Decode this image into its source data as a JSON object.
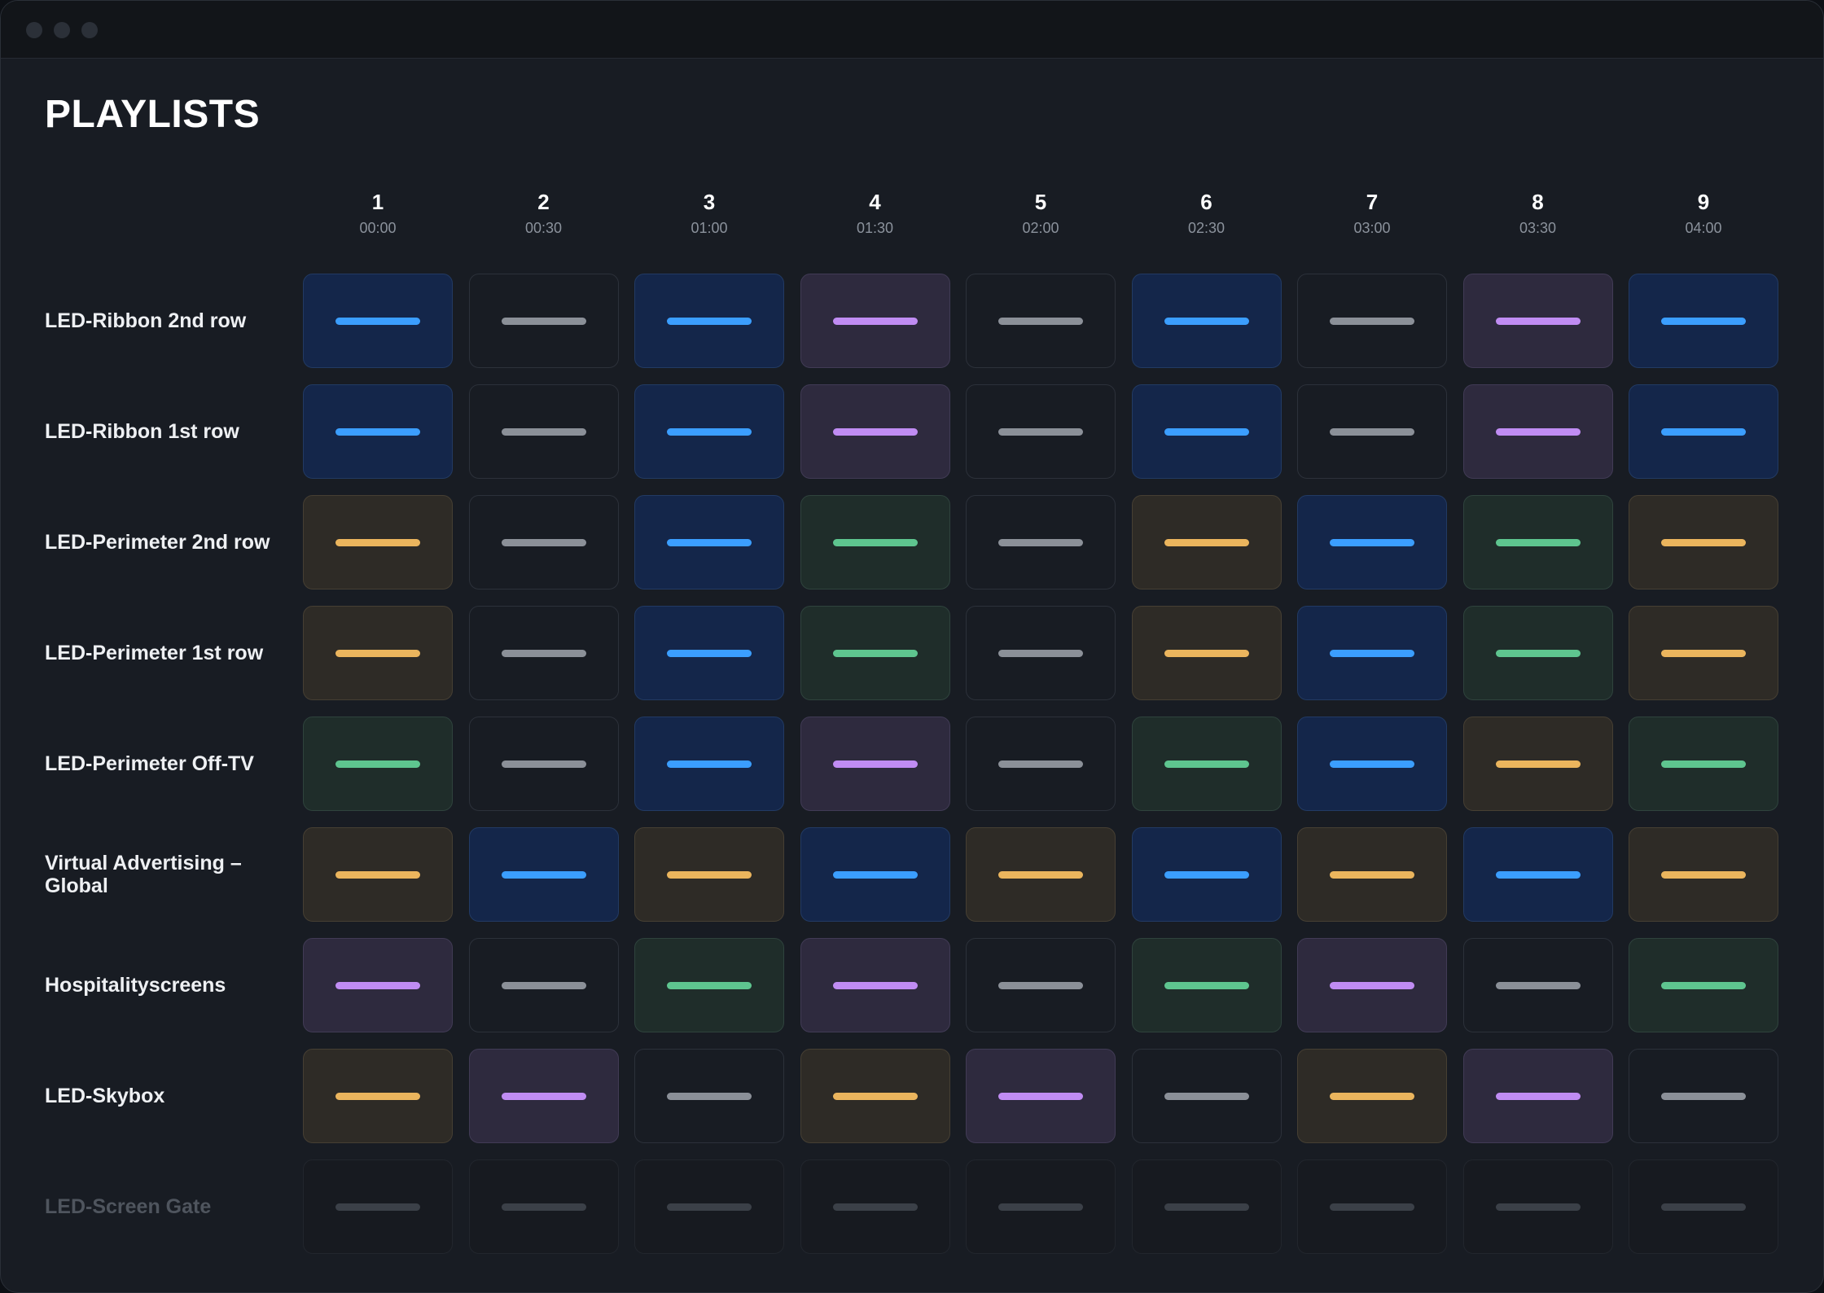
{
  "header": {
    "title": "PLAYLISTS"
  },
  "columns": [
    {
      "num": "1",
      "time": "00:00"
    },
    {
      "num": "2",
      "time": "00:30"
    },
    {
      "num": "3",
      "time": "01:00"
    },
    {
      "num": "4",
      "time": "01:30"
    },
    {
      "num": "5",
      "time": "02:00"
    },
    {
      "num": "6",
      "time": "02:30"
    },
    {
      "num": "7",
      "time": "03:00"
    },
    {
      "num": "8",
      "time": "03:30"
    },
    {
      "num": "9",
      "time": "04:00"
    }
  ],
  "rows": [
    {
      "label": "LED-Ribbon 2nd row",
      "disabled": false,
      "cells": [
        "blue",
        "gray",
        "blue",
        "purple",
        "gray",
        "blue",
        "gray",
        "purple",
        "blue"
      ]
    },
    {
      "label": "LED-Ribbon 1st row",
      "disabled": false,
      "cells": [
        "blue",
        "gray",
        "blue",
        "purple",
        "gray",
        "blue",
        "gray",
        "purple",
        "blue"
      ]
    },
    {
      "label": "LED-Perimeter 2nd row",
      "disabled": false,
      "cells": [
        "yellow",
        "gray",
        "blue",
        "green",
        "gray",
        "yellow",
        "blue",
        "green",
        "yellow"
      ]
    },
    {
      "label": "LED-Perimeter 1st row",
      "disabled": false,
      "cells": [
        "yellow",
        "gray",
        "blue",
        "green",
        "gray",
        "yellow",
        "blue",
        "green",
        "yellow"
      ]
    },
    {
      "label": "LED-Perimeter Off-TV",
      "disabled": false,
      "cells": [
        "green",
        "gray",
        "blue",
        "purple",
        "gray",
        "green",
        "blue",
        "yellow",
        "green"
      ]
    },
    {
      "label": "Virtual Advertising – Global",
      "disabled": false,
      "cells": [
        "yellow",
        "blue",
        "yellow",
        "blue",
        "yellow",
        "blue",
        "yellow",
        "blue",
        "yellow"
      ]
    },
    {
      "label": "Hospitalityscreens",
      "disabled": false,
      "cells": [
        "purple",
        "gray",
        "green",
        "purple",
        "gray",
        "green",
        "purple",
        "gray",
        "green"
      ]
    },
    {
      "label": "LED-Skybox",
      "disabled": false,
      "cells": [
        "yellow",
        "purple",
        "gray",
        "yellow",
        "purple",
        "gray",
        "yellow",
        "purple",
        "gray"
      ]
    },
    {
      "label": "LED-Screen Gate",
      "disabled": true,
      "cells": [
        "off",
        "off",
        "off",
        "off",
        "off",
        "off",
        "off",
        "off",
        "off"
      ]
    }
  ],
  "colors": {
    "blue": "#3b9eff",
    "purple": "#c08cf3",
    "yellow": "#ebb55d",
    "green": "#5ec58f",
    "gray": "#8b9098",
    "off": "#3b4048"
  }
}
